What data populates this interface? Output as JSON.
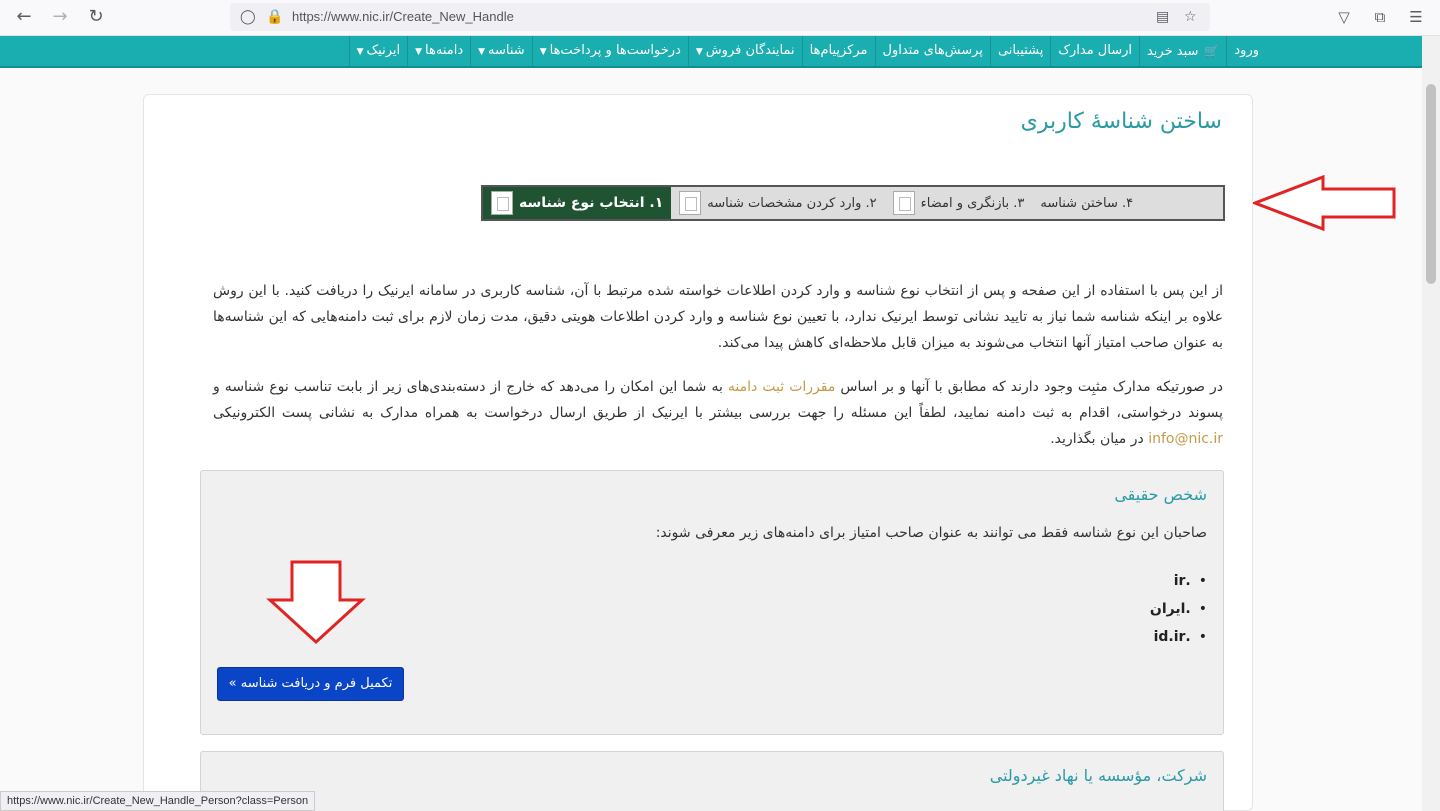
{
  "browser": {
    "url": "https://www.nic.ir/Create_New_Handle",
    "status_url": "https://www.nic.ir/Create_New_Handle_Person?class=Person"
  },
  "nav": {
    "items": [
      {
        "label": "ایرنیک",
        "caret": true
      },
      {
        "label": "دامنه‌ها",
        "caret": true
      },
      {
        "label": "شناسه",
        "caret": true
      },
      {
        "label": "درخواست‌ها و پرداخت‌ها",
        "caret": true
      },
      {
        "label": "نمایندگان فروش",
        "caret": true
      },
      {
        "label": "مرکزپیام‌ها",
        "caret": false
      },
      {
        "label": "پرسش‌های متداول",
        "caret": false
      },
      {
        "label": "پشتیبانی",
        "caret": false
      },
      {
        "label": "ارسال مدارک",
        "caret": false
      },
      {
        "label": "سبد خرید",
        "caret": false,
        "icon": "cart-icon"
      },
      {
        "label": "ورود",
        "caret": false
      }
    ]
  },
  "page": {
    "title": "ساختن شناسهٔ کاربری",
    "steps": [
      {
        "label": "۱.  انتخاب نوع شناسه",
        "active": true
      },
      {
        "label": "۲.  وارد کردن مشخصات شناسه",
        "active": false
      },
      {
        "label": "۳.  بازنگری و امضاء",
        "active": false
      },
      {
        "label": "۴.  ساختن شناسه",
        "active": false
      }
    ],
    "intro": "از این پس با استفاده از این صفحه و پس از انتخاب نوع شناسه و وارد کردن اطلاعات خواسته شده مرتبط با آن، شناسه کاربری در سامانه ایرنیک را دریافت کنید. با این روش علاوه بر اینکه شناسه شما نیاز به تایید نشانی توسط ایرنیک ندارد، با تعیین نوع شناسه و وارد کردن اطلاعات هویتی دقیق، مدت زمان لازم برای ثبت دامنه‌هایی که این شناسه‌ها به عنوان صاحب امتیاز آنها انتخاب می‌شوند به میزان قابل ملاحظه‌ای کاهش پیدا می‌کند.",
    "note_part1": "در صورتیکه مدارک مثبِت وجود دارند که مطابق با آنها و بر اساس ",
    "note_link": "مقررات ثبت دامنه",
    "note_part2": " به شما این امکان را می‌دهد که خارج از دسته‌بندی‌های زیر از بابت تناسب نوع شناسه و پسوند درخواستی، اقدام به ثبت دامنه نمایید، لطفاً این مسئله را جهت بررسی بیشتر با ایرنیک از طریق ارسال درخواست به همراه مدارک به نشانی پست الکترونیکی ",
    "note_email": "info@nic.ir",
    "note_part3": " در میان بگذارید."
  },
  "person_box": {
    "title": "شخص حقیقی",
    "desc": "صاحبان این نوع شناسه فقط می توانند به عنوان صاحب امتیاز برای دامنه‌های زیر معرفی شوند:",
    "domains": [
      ".ir",
      ".ایران",
      ".id.ir"
    ],
    "button": "تکمیل فرم و دریافت شناسه »"
  },
  "company_box": {
    "title": "شرکت، مؤسسه یا نهاد غیردولتی"
  },
  "colors": {
    "nav": "#1aaeb0",
    "active_step": "#1f5331",
    "title": "#2a9aa5",
    "button": "#0a45c8",
    "arrow": "#e02424",
    "link": "#c29b46"
  }
}
